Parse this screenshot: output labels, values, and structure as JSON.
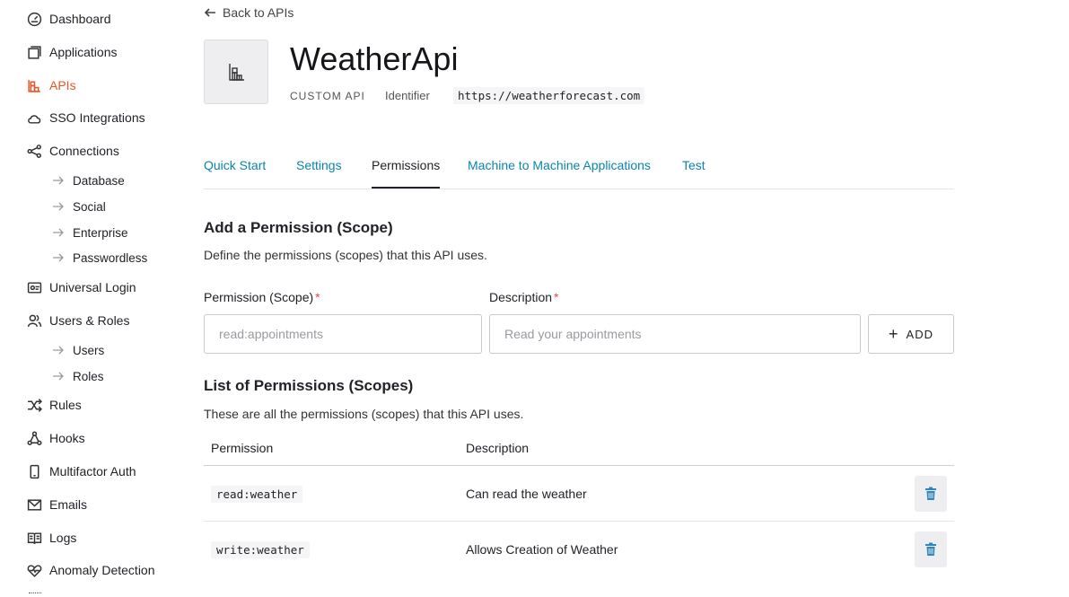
{
  "sidebar": {
    "items": [
      {
        "label": "Dashboard",
        "icon": "dashboard-icon"
      },
      {
        "label": "Applications",
        "icon": "applications-icon"
      },
      {
        "label": "APIs",
        "icon": "apis-icon",
        "active": true
      },
      {
        "label": "SSO Integrations",
        "icon": "cloud-icon"
      },
      {
        "label": "Connections",
        "icon": "share-icon"
      },
      {
        "label": "Universal Login",
        "icon": "login-icon"
      },
      {
        "label": "Users & Roles",
        "icon": "users-icon"
      },
      {
        "label": "Rules",
        "icon": "shuffle-icon"
      },
      {
        "label": "Hooks",
        "icon": "hooks-icon"
      },
      {
        "label": "Multifactor Auth",
        "icon": "phone-icon"
      },
      {
        "label": "Emails",
        "icon": "mail-icon"
      },
      {
        "label": "Logs",
        "icon": "book-icon"
      },
      {
        "label": "Anomaly Detection",
        "icon": "heart-icon"
      }
    ],
    "connections_sub": [
      "Database",
      "Social",
      "Enterprise",
      "Passwordless"
    ],
    "users_sub": [
      "Users",
      "Roles"
    ]
  },
  "header": {
    "back_label": "Back to APIs",
    "title": "WeatherApi",
    "type_label": "CUSTOM API",
    "identifier_label": "Identifier",
    "identifier_value": "https://weatherforecast.com"
  },
  "tabs": [
    {
      "label": "Quick Start"
    },
    {
      "label": "Settings"
    },
    {
      "label": "Permissions",
      "active": true
    },
    {
      "label": "Machine to Machine Applications"
    },
    {
      "label": "Test"
    }
  ],
  "add_section": {
    "title": "Add a Permission (Scope)",
    "description": "Define the permissions (scopes) that this API uses.",
    "permission_label": "Permission (Scope)",
    "permission_placeholder": "read:appointments",
    "description_label": "Description",
    "description_placeholder": "Read your appointments",
    "required_mark": "*",
    "add_button_label": "ADD"
  },
  "list_section": {
    "title": "List of Permissions (Scopes)",
    "description": "These are all the permissions (scopes) that this API uses.",
    "columns": [
      "Permission",
      "Description"
    ],
    "rows": [
      {
        "permission": "read:weather",
        "description": "Can read the weather"
      },
      {
        "permission": "write:weather",
        "description": "Allows Creation of Weather"
      }
    ]
  },
  "colors": {
    "accent": "#eb5424",
    "link": "#0a84ae",
    "trash": "#2e86c1"
  }
}
